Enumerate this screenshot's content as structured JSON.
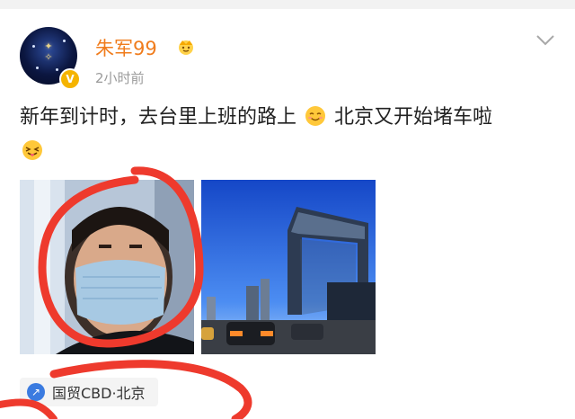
{
  "post": {
    "username": "朱军99",
    "time": "2小时前",
    "verified_badge": "V",
    "text_part1": "新年到计时，去台里上班的路上",
    "text_part2": "北京又开始堵车啦",
    "location": "国贸CBD·北京"
  },
  "icons": {
    "crown": "crown-icon",
    "chevron": "chevron-down-icon",
    "location": "location-icon",
    "emoji_smile": "smile-emoji",
    "emoji_tongue": "tongue-wink-emoji"
  },
  "colors": {
    "username": "#f07c1c",
    "time": "#9b9b9b",
    "scribble": "#ee3a2d",
    "badge": "#f5b400",
    "location_icon": "#3b7be0"
  }
}
